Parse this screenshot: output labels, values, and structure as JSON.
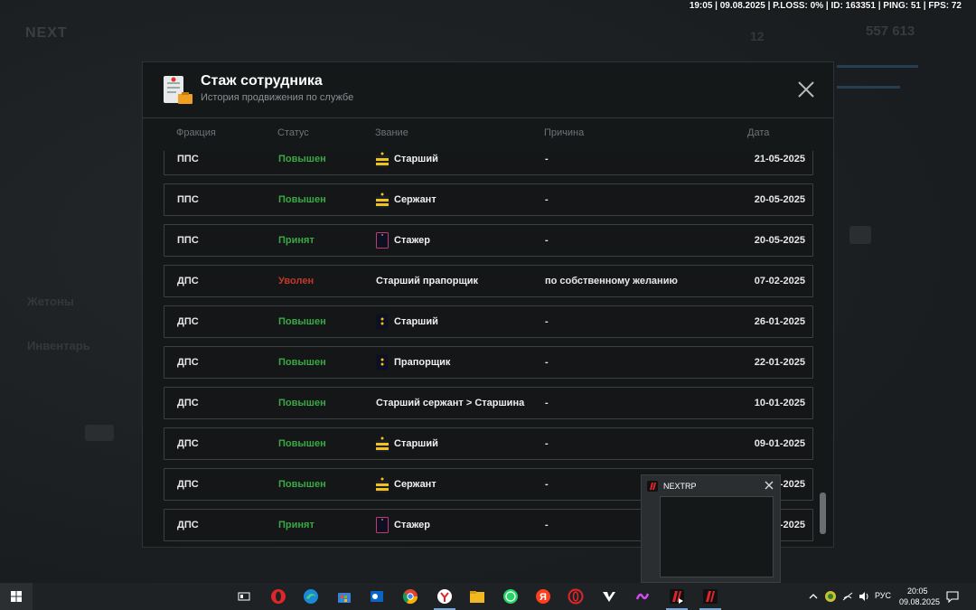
{
  "hud": "19:05 | 09.08.2025 | P.LOSS: 0% | ID: 163351 | PING: 51 | FPS: 72",
  "background": {
    "logo": "NEXT",
    "money": "557 613",
    "number": "12",
    "side_items": [
      "Жетоны",
      "Инвентарь"
    ]
  },
  "modal": {
    "title": "Стаж сотрудника",
    "subtitle": "История продвижения по службе",
    "columns": {
      "fraction": "Фракция",
      "status": "Статус",
      "rank": "Звание",
      "reason": "Причина",
      "date": "Дата"
    },
    "rows": [
      {
        "fraction": "ППС",
        "status": "Повышен",
        "status_color": "#3aa844",
        "rank": "Старший",
        "rank_icon": "chevron-yellow",
        "reason": "-",
        "date": "21-05-2025"
      },
      {
        "fraction": "ППС",
        "status": "Повышен",
        "status_color": "#3aa844",
        "rank": "Сержант",
        "rank_icon": "chevron-yellow",
        "reason": "-",
        "date": "20-05-2025"
      },
      {
        "fraction": "ППС",
        "status": "Принят",
        "status_color": "#3aa844",
        "rank": "Стажер",
        "rank_icon": "shoulder-plain",
        "reason": "-",
        "date": "20-05-2025"
      },
      {
        "fraction": "ДПС",
        "status": "Уволен",
        "status_color": "#c0392b",
        "rank": "Старший прапорщик",
        "rank_icon": "",
        "reason": "по собственному желанию",
        "date": "07-02-2025"
      },
      {
        "fraction": "ДПС",
        "status": "Повышен",
        "status_color": "#3aa844",
        "rank": "Старший",
        "rank_icon": "shoulder-stars",
        "reason": "-",
        "date": "26-01-2025"
      },
      {
        "fraction": "ДПС",
        "status": "Повышен",
        "status_color": "#3aa844",
        "rank": "Прапорщик",
        "rank_icon": "shoulder-stars",
        "reason": "-",
        "date": "22-01-2025"
      },
      {
        "fraction": "ДПС",
        "status": "Повышен",
        "status_color": "#3aa844",
        "rank": "Старший сержант > Старшина",
        "rank_icon": "",
        "reason": "-",
        "date": "10-01-2025"
      },
      {
        "fraction": "ДПС",
        "status": "Повышен",
        "status_color": "#3aa844",
        "rank": "Старший",
        "rank_icon": "chevron-yellow",
        "reason": "-",
        "date": "09-01-2025"
      },
      {
        "fraction": "ДПС",
        "status": "Повышен",
        "status_color": "#3aa844",
        "rank": "Сержант",
        "rank_icon": "chevron-yellow",
        "reason": "-",
        "date": "08-01-2025"
      },
      {
        "fraction": "ДПС",
        "status": "Принят",
        "status_color": "#3aa844",
        "rank": "Стажер",
        "rank_icon": "shoulder-plain",
        "reason": "-",
        "date": "05-01-2025"
      }
    ]
  },
  "thumbnail": {
    "title": "NEXTRP"
  },
  "taskbar": {
    "apps": [
      "task-view",
      "opera",
      "edge",
      "store",
      "outlook",
      "chrome",
      "yandex-browser",
      "file-explorer",
      "whatsapp",
      "yandex",
      "opera-gx",
      "cursor-app",
      "tilda-app",
      "nextrp-launcher",
      "nextrp"
    ],
    "lang": "РУС",
    "time": "20:05",
    "date": "09.08.2025"
  }
}
